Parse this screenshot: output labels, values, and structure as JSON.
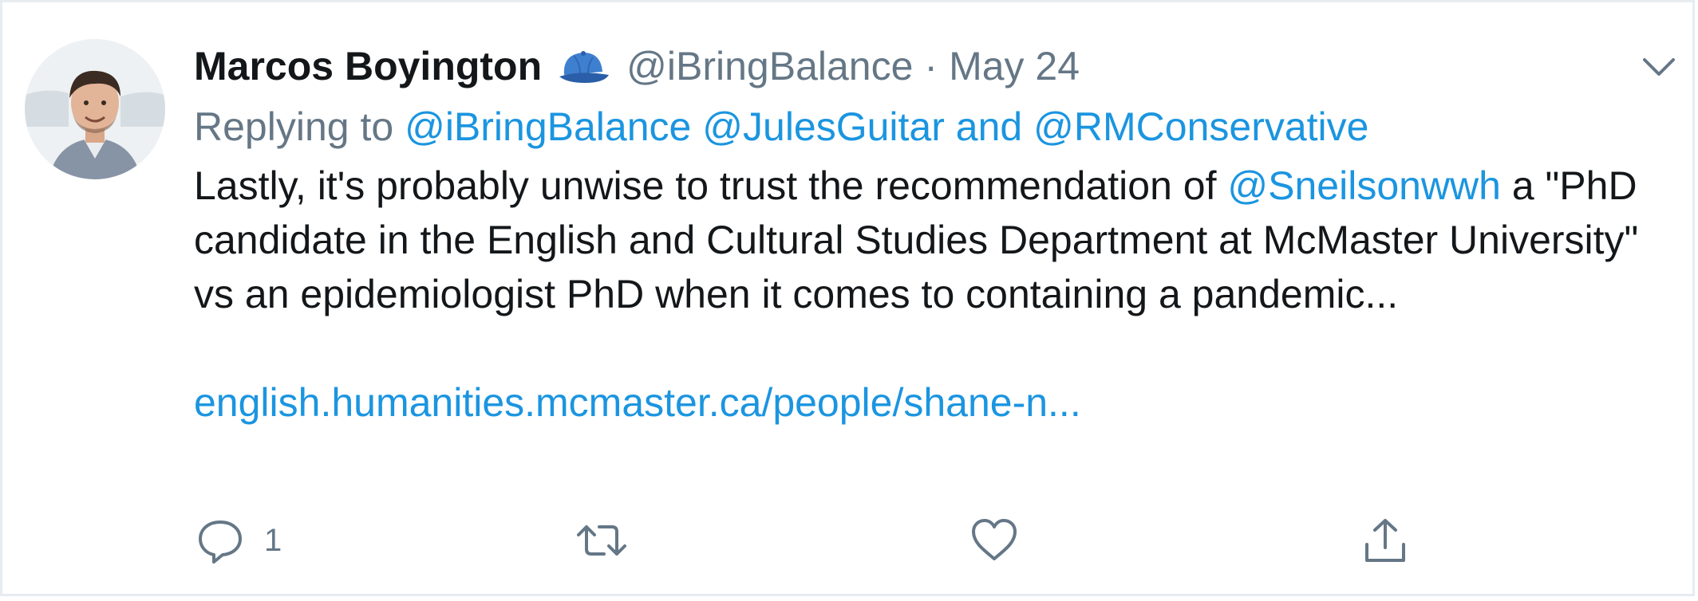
{
  "tweet": {
    "author_name": "Marcos Boyington",
    "author_emoji_icon": "baseball-cap-icon",
    "handle": "@iBringBalance",
    "separator": "·",
    "date": "May 24",
    "reply_prefix": "Replying to",
    "reply_mentions": [
      "@iBringBalance",
      "@JulesGuitar",
      "and",
      "@RMConservative"
    ],
    "body": {
      "part1": "Lastly, it's probably unwise to trust the recommendation of ",
      "mention": "@Sneilsonwwh",
      "part2": " a \"PhD candidate in the English and Cultural Studies Department at McMaster University\" vs an epidemiologist PhD when it comes to containing a pandemic..."
    },
    "link_text": "english.humanities.mcmaster.ca/people/shane-n...",
    "actions": {
      "reply_count": "1",
      "retweet_count": "",
      "like_count": ""
    },
    "colors": {
      "link": "#1b95e0",
      "muted": "#657786",
      "text": "#14171a",
      "border": "#e6ecf0"
    }
  }
}
